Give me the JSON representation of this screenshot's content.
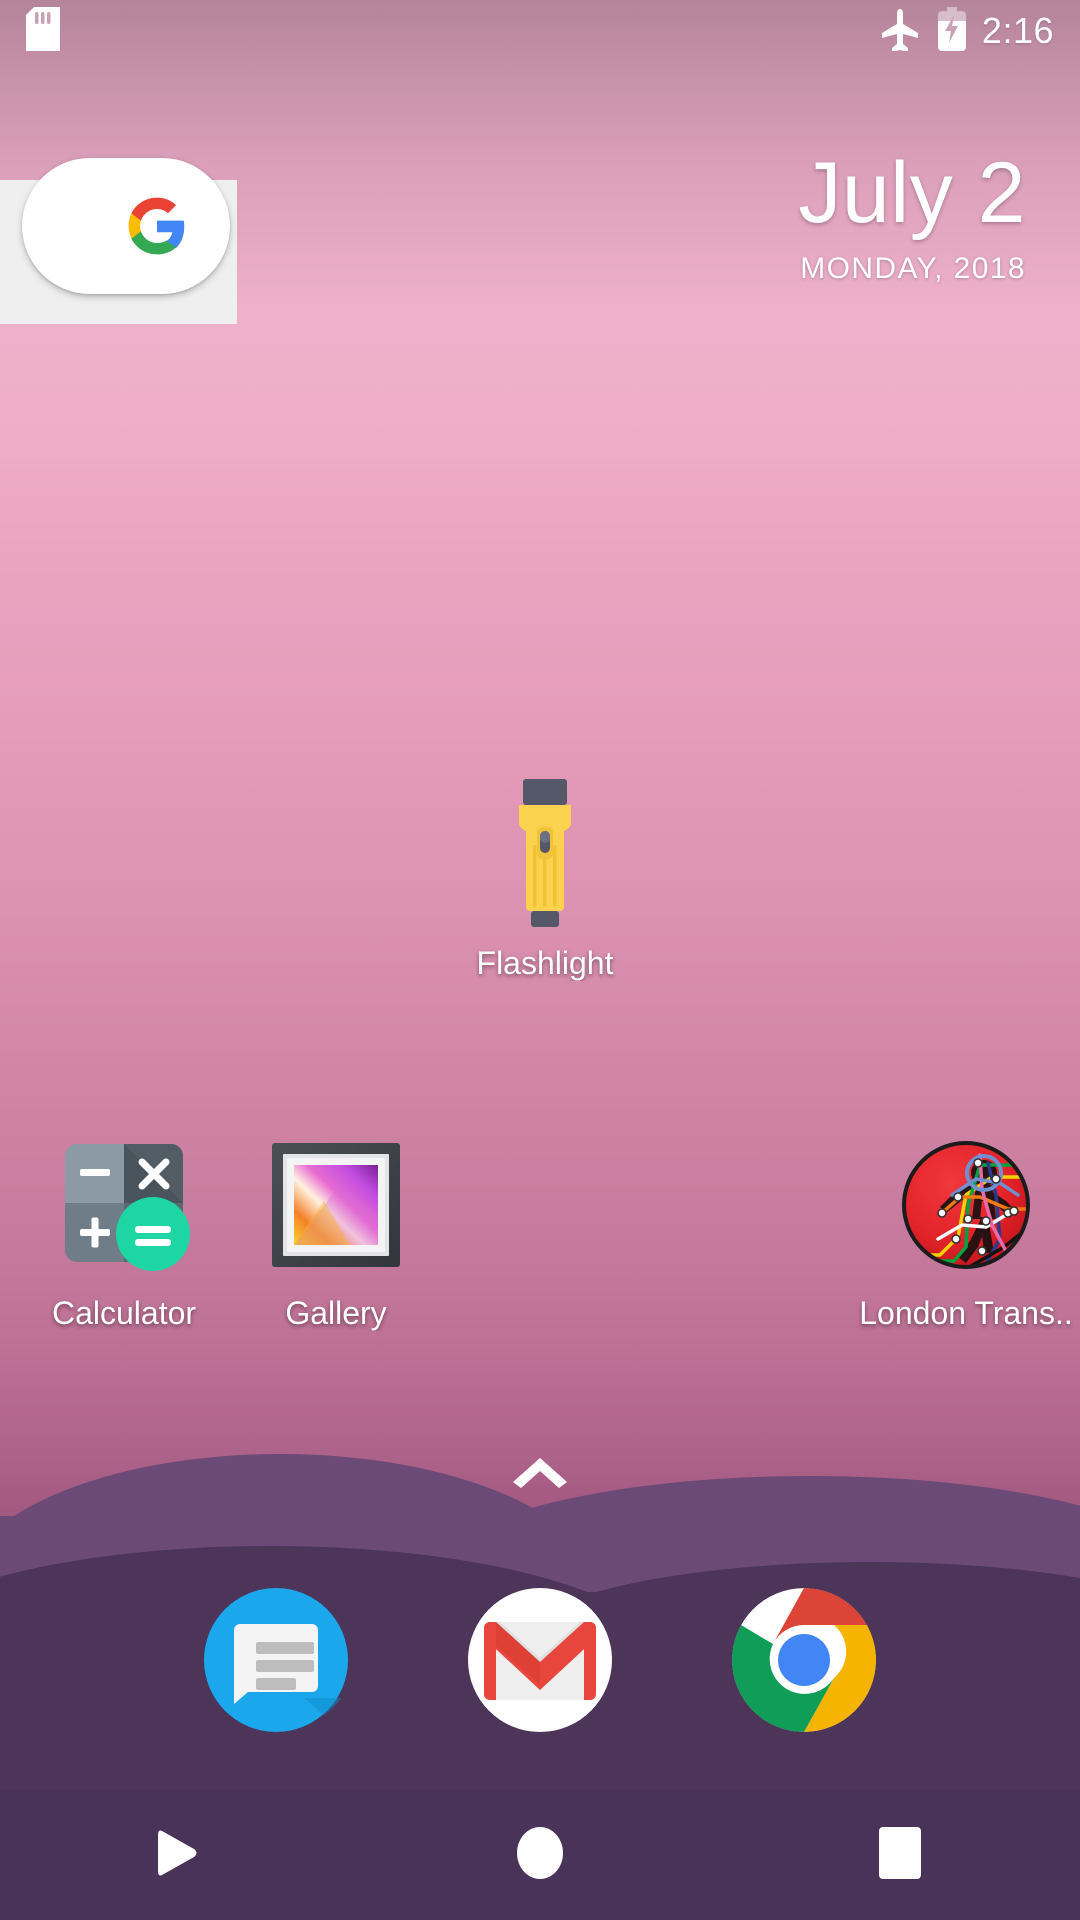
{
  "status_bar": {
    "time": "2:16",
    "icons": [
      "sd-card-icon",
      "airplane-mode-icon",
      "battery-charging-icon"
    ]
  },
  "search_widget": {
    "name": "google-search-widget",
    "logo": "google-g-logo"
  },
  "date_widget": {
    "date": "July 2",
    "day_year": "MONDAY, 2018"
  },
  "apps": [
    {
      "label": "Flashlight",
      "icon": "flashlight-icon"
    },
    {
      "label": "Calculator",
      "icon": "calculator-icon"
    },
    {
      "label": "Gallery",
      "icon": "gallery-icon"
    },
    {
      "label": "London Trans..",
      "icon": "london-transport-icon"
    }
  ],
  "drawer": {
    "handle_icon": "chevron-up-icon"
  },
  "dock": [
    {
      "name": "messages",
      "icon": "messages-icon"
    },
    {
      "name": "gmail",
      "icon": "gmail-icon"
    },
    {
      "name": "chrome",
      "icon": "chrome-icon"
    }
  ],
  "nav_bar": [
    {
      "name": "back",
      "icon": "back-triangle-icon"
    },
    {
      "name": "home",
      "icon": "home-circle-icon"
    },
    {
      "name": "recents",
      "icon": "recents-square-icon"
    }
  ],
  "colors": {
    "nav_bar_bg": "#4a3358",
    "accent_green": "#1ed6a4",
    "transport_red": "#e8232a"
  }
}
